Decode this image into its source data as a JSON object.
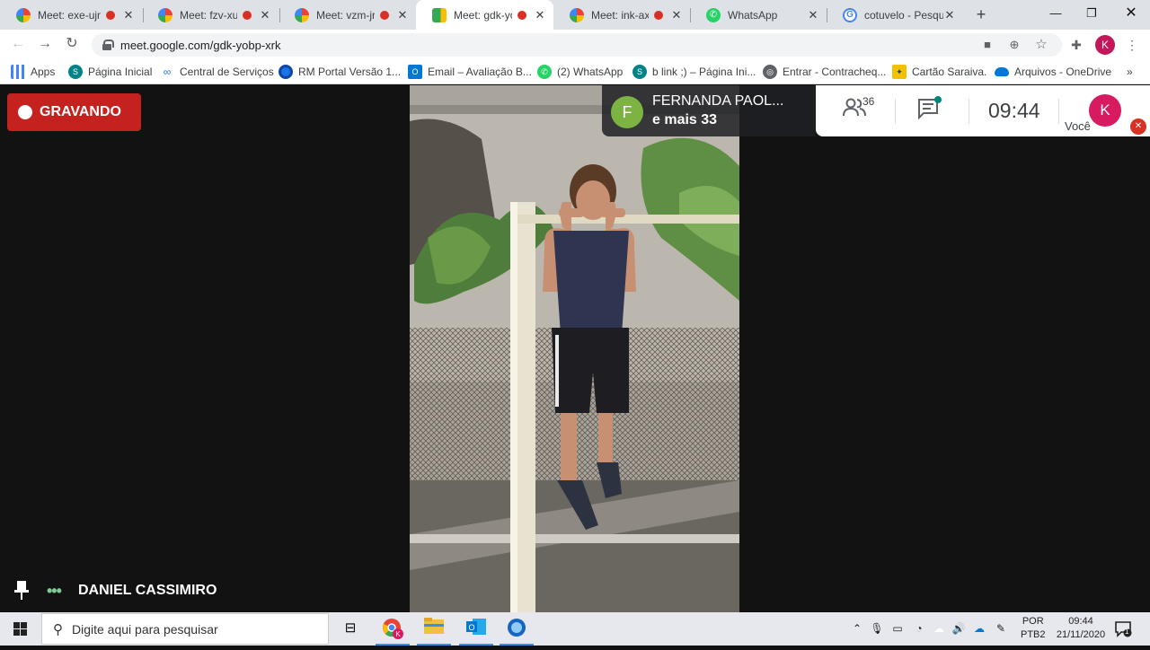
{
  "browser": {
    "tabs": [
      {
        "title": "Meet: exe-ujm",
        "recording": true,
        "active": false
      },
      {
        "title": "Meet: fzv-xukz",
        "recording": true,
        "active": false
      },
      {
        "title": "Meet: vzm-jrfb",
        "recording": true,
        "active": false
      },
      {
        "title": "Meet: gdk-yobp",
        "recording": true,
        "active": true
      },
      {
        "title": "Meet: ink-axtk",
        "recording": true,
        "active": false
      },
      {
        "title": "WhatsApp",
        "recording": false,
        "active": false
      },
      {
        "title": "cotuvelo - Pesquisa",
        "recording": false,
        "active": false
      }
    ],
    "new_tab_label": "+",
    "url": "meet.google.com/gdk-yobp-xrk",
    "profile_initial": "K",
    "bookmarks": [
      {
        "label": "Apps",
        "icon": "apps-grid-icon",
        "color": "#4285f4"
      },
      {
        "label": "Página Inicial",
        "icon": "sharepoint-icon",
        "color": "#038387"
      },
      {
        "label": "Central de Serviços",
        "icon": "link-icon",
        "color": "#5f6368"
      },
      {
        "label": "RM Portal Versão 1...",
        "icon": "globe-icon",
        "color": "#1a73e8"
      },
      {
        "label": "Email – Avaliação B...",
        "icon": "outlook-icon",
        "color": "#0078d4"
      },
      {
        "label": "(2) WhatsApp",
        "icon": "whatsapp-icon",
        "color": "#25d366"
      },
      {
        "label": "b link ;) – Página Ini...",
        "icon": "sharepoint-icon",
        "color": "#038387"
      },
      {
        "label": "Entrar - Contracheq...",
        "icon": "globe-icon",
        "color": "#5f6368"
      },
      {
        "label": "Cartão Saraiva.",
        "icon": "bank-icon",
        "color": "#f2c200"
      },
      {
        "label": "Arquivos - OneDrive",
        "icon": "onedrive-icon",
        "color": "#0078d4"
      }
    ],
    "bookmarks_more": "»"
  },
  "meet": {
    "recording_label": "GRAVANDO",
    "speaker": {
      "initial": "F",
      "name": "FERNANDA PAOL...",
      "more": "e mais 33"
    },
    "participants_count": "36",
    "time": "09:44",
    "self": {
      "initial": "K",
      "label": "Você"
    },
    "pinned_participant": "DANIEL CASSIMIRO"
  },
  "taskbar": {
    "search_placeholder": "Digite aqui para pesquisar",
    "lang_top": "POR",
    "lang_bottom": "PTB2",
    "time": "09:44",
    "date": "21/11/2020",
    "notification_count": "1"
  },
  "colors": {
    "recording_red": "#c5221f",
    "meet_green": "#81c995",
    "speaker_avatar": "#7cb342",
    "self_avatar": "#d81b60"
  }
}
